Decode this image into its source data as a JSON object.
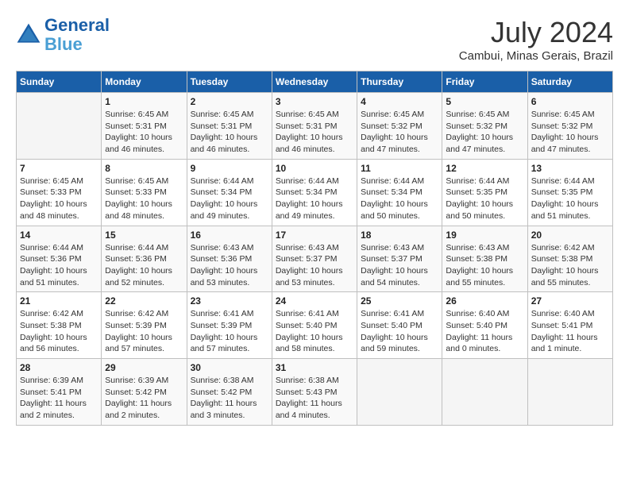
{
  "header": {
    "logo_line1": "General",
    "logo_line2": "Blue",
    "title": "July 2024",
    "location": "Cambui, Minas Gerais, Brazil"
  },
  "days_of_week": [
    "Sunday",
    "Monday",
    "Tuesday",
    "Wednesday",
    "Thursday",
    "Friday",
    "Saturday"
  ],
  "weeks": [
    [
      {
        "day": "",
        "info": ""
      },
      {
        "day": "1",
        "info": "Sunrise: 6:45 AM\nSunset: 5:31 PM\nDaylight: 10 hours\nand 46 minutes."
      },
      {
        "day": "2",
        "info": "Sunrise: 6:45 AM\nSunset: 5:31 PM\nDaylight: 10 hours\nand 46 minutes."
      },
      {
        "day": "3",
        "info": "Sunrise: 6:45 AM\nSunset: 5:31 PM\nDaylight: 10 hours\nand 46 minutes."
      },
      {
        "day": "4",
        "info": "Sunrise: 6:45 AM\nSunset: 5:32 PM\nDaylight: 10 hours\nand 47 minutes."
      },
      {
        "day": "5",
        "info": "Sunrise: 6:45 AM\nSunset: 5:32 PM\nDaylight: 10 hours\nand 47 minutes."
      },
      {
        "day": "6",
        "info": "Sunrise: 6:45 AM\nSunset: 5:32 PM\nDaylight: 10 hours\nand 47 minutes."
      }
    ],
    [
      {
        "day": "7",
        "info": "Sunrise: 6:45 AM\nSunset: 5:33 PM\nDaylight: 10 hours\nand 48 minutes."
      },
      {
        "day": "8",
        "info": "Sunrise: 6:45 AM\nSunset: 5:33 PM\nDaylight: 10 hours\nand 48 minutes."
      },
      {
        "day": "9",
        "info": "Sunrise: 6:44 AM\nSunset: 5:34 PM\nDaylight: 10 hours\nand 49 minutes."
      },
      {
        "day": "10",
        "info": "Sunrise: 6:44 AM\nSunset: 5:34 PM\nDaylight: 10 hours\nand 49 minutes."
      },
      {
        "day": "11",
        "info": "Sunrise: 6:44 AM\nSunset: 5:34 PM\nDaylight: 10 hours\nand 50 minutes."
      },
      {
        "day": "12",
        "info": "Sunrise: 6:44 AM\nSunset: 5:35 PM\nDaylight: 10 hours\nand 50 minutes."
      },
      {
        "day": "13",
        "info": "Sunrise: 6:44 AM\nSunset: 5:35 PM\nDaylight: 10 hours\nand 51 minutes."
      }
    ],
    [
      {
        "day": "14",
        "info": "Sunrise: 6:44 AM\nSunset: 5:36 PM\nDaylight: 10 hours\nand 51 minutes."
      },
      {
        "day": "15",
        "info": "Sunrise: 6:44 AM\nSunset: 5:36 PM\nDaylight: 10 hours\nand 52 minutes."
      },
      {
        "day": "16",
        "info": "Sunrise: 6:43 AM\nSunset: 5:36 PM\nDaylight: 10 hours\nand 53 minutes."
      },
      {
        "day": "17",
        "info": "Sunrise: 6:43 AM\nSunset: 5:37 PM\nDaylight: 10 hours\nand 53 minutes."
      },
      {
        "day": "18",
        "info": "Sunrise: 6:43 AM\nSunset: 5:37 PM\nDaylight: 10 hours\nand 54 minutes."
      },
      {
        "day": "19",
        "info": "Sunrise: 6:43 AM\nSunset: 5:38 PM\nDaylight: 10 hours\nand 55 minutes."
      },
      {
        "day": "20",
        "info": "Sunrise: 6:42 AM\nSunset: 5:38 PM\nDaylight: 10 hours\nand 55 minutes."
      }
    ],
    [
      {
        "day": "21",
        "info": "Sunrise: 6:42 AM\nSunset: 5:38 PM\nDaylight: 10 hours\nand 56 minutes."
      },
      {
        "day": "22",
        "info": "Sunrise: 6:42 AM\nSunset: 5:39 PM\nDaylight: 10 hours\nand 57 minutes."
      },
      {
        "day": "23",
        "info": "Sunrise: 6:41 AM\nSunset: 5:39 PM\nDaylight: 10 hours\nand 57 minutes."
      },
      {
        "day": "24",
        "info": "Sunrise: 6:41 AM\nSunset: 5:40 PM\nDaylight: 10 hours\nand 58 minutes."
      },
      {
        "day": "25",
        "info": "Sunrise: 6:41 AM\nSunset: 5:40 PM\nDaylight: 10 hours\nand 59 minutes."
      },
      {
        "day": "26",
        "info": "Sunrise: 6:40 AM\nSunset: 5:40 PM\nDaylight: 11 hours\nand 0 minutes."
      },
      {
        "day": "27",
        "info": "Sunrise: 6:40 AM\nSunset: 5:41 PM\nDaylight: 11 hours\nand 1 minute."
      }
    ],
    [
      {
        "day": "28",
        "info": "Sunrise: 6:39 AM\nSunset: 5:41 PM\nDaylight: 11 hours\nand 2 minutes."
      },
      {
        "day": "29",
        "info": "Sunrise: 6:39 AM\nSunset: 5:42 PM\nDaylight: 11 hours\nand 2 minutes."
      },
      {
        "day": "30",
        "info": "Sunrise: 6:38 AM\nSunset: 5:42 PM\nDaylight: 11 hours\nand 3 minutes."
      },
      {
        "day": "31",
        "info": "Sunrise: 6:38 AM\nSunset: 5:43 PM\nDaylight: 11 hours\nand 4 minutes."
      },
      {
        "day": "",
        "info": ""
      },
      {
        "day": "",
        "info": ""
      },
      {
        "day": "",
        "info": ""
      }
    ]
  ]
}
